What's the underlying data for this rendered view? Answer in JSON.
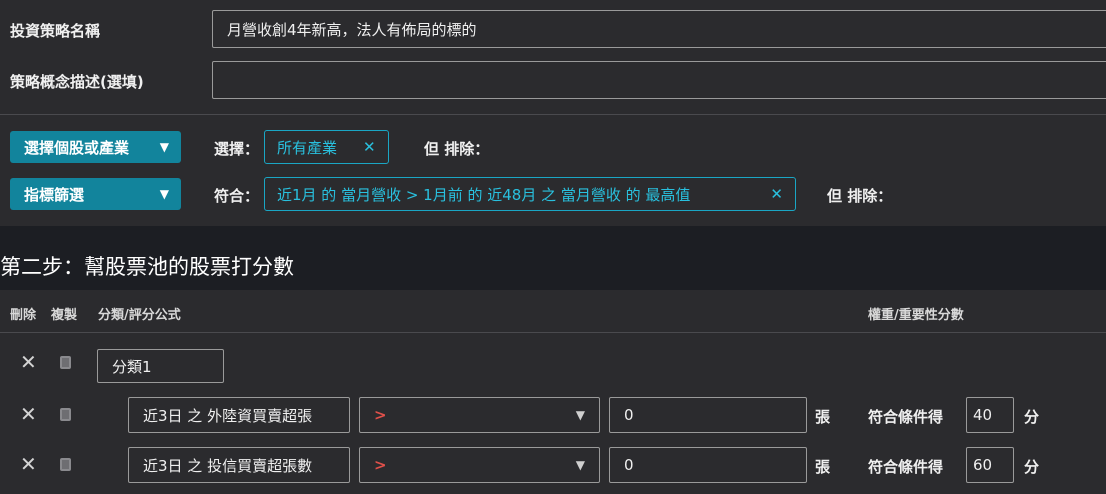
{
  "strategy": {
    "name_label": "投資策略名稱",
    "name_value": "月營收創4年新高，法人有佈局的標的",
    "desc_label": "策略概念描述(選填)",
    "desc_value": ""
  },
  "filters": {
    "stock_button": "選擇個股或產業",
    "indicator_button": "指標篩選",
    "select_label": "選擇：",
    "select_tag": "所有產業",
    "exclude_label": "但 排除：",
    "match_label": "符合：",
    "match_tag": "近1月 的 當月營收 > 1月前 的 近48月 之 當月營收 的 最高值",
    "match_exclude_label": "但 排除：",
    "close_glyph": "✕"
  },
  "step2": {
    "title": "第二步：幫股票池的股票打分數",
    "col_delete": "刪除",
    "col_copy": "複製",
    "col_formula": "分類/評分公式",
    "col_weight": "權重/重要性分數"
  },
  "rows": {
    "category": "分類1",
    "row1": {
      "name": "近3日 之 外陸資買賣超張",
      "operator": ">",
      "value": "0",
      "unit": "張",
      "score_label": "符合條件得",
      "score": "40",
      "score_unit": "分"
    },
    "row2": {
      "name": "近3日 之 投信買賣超張數",
      "operator": ">",
      "value": "0",
      "unit": "張",
      "score_label": "符合條件得",
      "score": "60",
      "score_unit": "分"
    }
  },
  "icons": {
    "delete": "close-icon",
    "copy": "copy-icon",
    "dropdown": "chevron-down-icon"
  },
  "colors": {
    "accent": "#12849c",
    "tag": "#29c0de",
    "operator": "#e0504a",
    "section_bg": "#1c1e23"
  }
}
